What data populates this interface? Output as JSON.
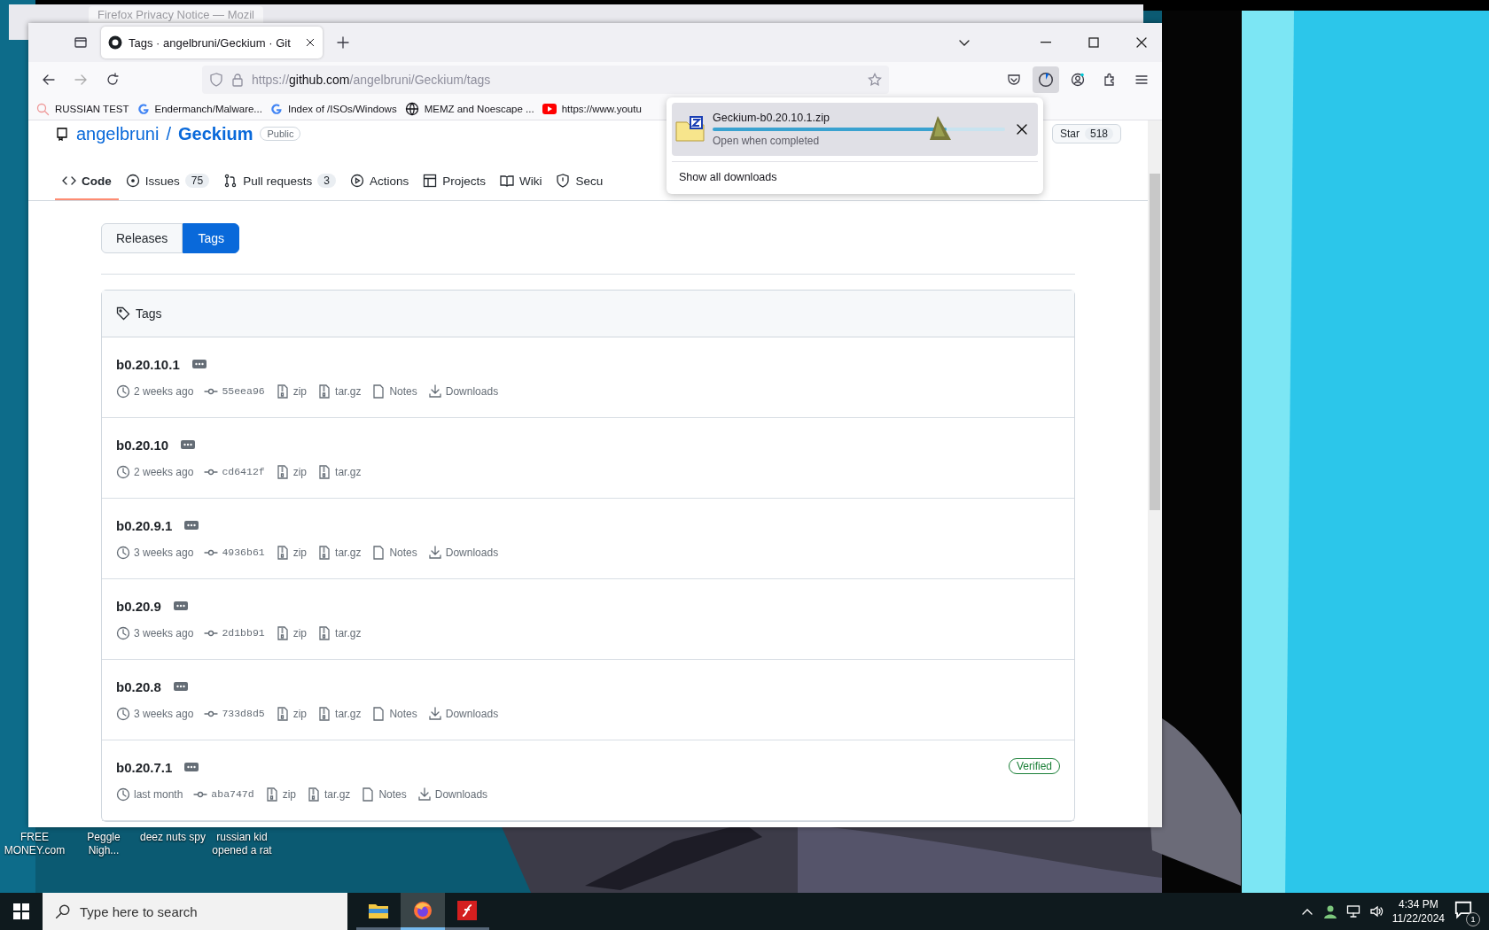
{
  "background_window": {
    "tab_title": "Firefox Privacy Notice — Mozil"
  },
  "browser": {
    "tab": {
      "title": "Tags · angelbruni/Geckium · Git",
      "selected": true
    },
    "url": {
      "prefix": "https://",
      "host": "github.com",
      "path": "/angelbruni/Geckium/tags"
    },
    "bookmarks": [
      {
        "kind": "search",
        "label": "RUSSIAN TEST"
      },
      {
        "kind": "google",
        "label": "Endermanch/Malware..."
      },
      {
        "kind": "google",
        "label": "Index of /ISOs/Windows"
      },
      {
        "kind": "globe",
        "label": "MEMZ and Noescape ..."
      },
      {
        "kind": "youtube",
        "label": "https://www.youtu"
      }
    ]
  },
  "repo": {
    "owner": "angelbruni",
    "separator": "/",
    "name": "Geckium",
    "visibility": "Public",
    "star_label": "Star",
    "star_count": "518",
    "nav": [
      {
        "label": "Code",
        "kind": "code",
        "selected": true
      },
      {
        "label": "Issues",
        "kind": "issues",
        "count": "75",
        "selected": false
      },
      {
        "label": "Pull requests",
        "kind": "pulls",
        "count": "3",
        "selected": false
      },
      {
        "label": "Actions",
        "kind": "actions",
        "selected": false
      },
      {
        "label": "Projects",
        "kind": "projects",
        "selected": false
      },
      {
        "label": "Wiki",
        "kind": "wiki",
        "selected": false
      },
      {
        "label": "Secu",
        "kind": "security",
        "selected": false
      }
    ]
  },
  "toggle": [
    {
      "label": "Releases",
      "selected": false
    },
    {
      "label": "Tags",
      "selected": true
    }
  ],
  "tags_box": {
    "title": "Tags",
    "rows": [
      {
        "tag": "b0.20.10.1",
        "time": "2 weeks ago",
        "commit": "55eea96",
        "zip": "zip",
        "tar": "tar.gz",
        "notes": "Notes",
        "downloads": "Downloads"
      },
      {
        "tag": "b0.20.10",
        "time": "2 weeks ago",
        "commit": "cd6412f",
        "zip": "zip",
        "tar": "tar.gz"
      },
      {
        "tag": "b0.20.9.1",
        "time": "3 weeks ago",
        "commit": "4936b61",
        "zip": "zip",
        "tar": "tar.gz",
        "notes": "Notes",
        "downloads": "Downloads"
      },
      {
        "tag": "b0.20.9",
        "time": "3 weeks ago",
        "commit": "2d1bb91",
        "zip": "zip",
        "tar": "tar.gz"
      },
      {
        "tag": "b0.20.8",
        "time": "3 weeks ago",
        "commit": "733d8d5",
        "zip": "zip",
        "tar": "tar.gz",
        "notes": "Notes",
        "downloads": "Downloads"
      },
      {
        "tag": "b0.20.7.1",
        "time": "last month",
        "commit": "aba747d",
        "zip": "zip",
        "tar": "tar.gz",
        "notes": "Notes",
        "downloads": "Downloads",
        "verified": "Verified"
      }
    ]
  },
  "downloads_panel": {
    "file": "Geckium-b0.20.10.1.zip",
    "level": 0.8,
    "status": "Open when completed",
    "show_all": "Show all downloads"
  },
  "desktop_icons": [
    {
      "label": "FREE\nMONEY.com"
    },
    {
      "label": "Peggle\nNigh..."
    },
    {
      "label": "deez nuts spy"
    },
    {
      "label": "russian kid\nopened a rat"
    }
  ],
  "taskbar": {
    "search_placeholder": "Type here to search",
    "apps": [
      {
        "kind": "explorer",
        "active": false
      },
      {
        "kind": "firefox",
        "active": true
      },
      {
        "kind": "flash",
        "active": false
      }
    ],
    "time": "4:34 PM",
    "date": "11/22/2024",
    "notifications": "1"
  }
}
